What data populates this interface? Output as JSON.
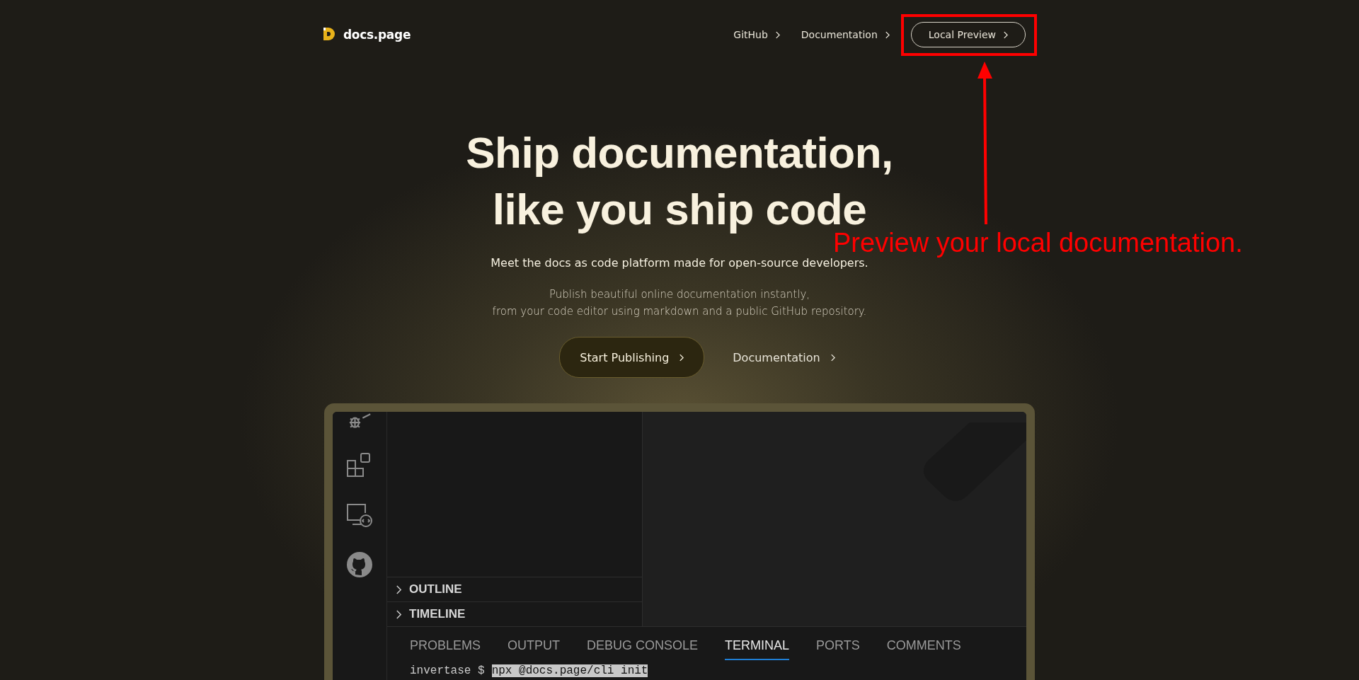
{
  "header": {
    "logo_text": "docs.page",
    "nav": [
      {
        "label": "GitHub",
        "kind": "link"
      },
      {
        "label": "Documentation",
        "kind": "link"
      },
      {
        "label": "Local Preview",
        "kind": "button"
      }
    ]
  },
  "hero": {
    "title_lines": [
      "Ship documentation,",
      "like you ship code"
    ],
    "subtitle": "Meet the docs as code platform made for open-source developers.",
    "description_lines": [
      "Publish beautiful online documentation instantly,",
      "from your code editor using markdown and a public GitHub repository."
    ],
    "actions": [
      {
        "label": "Start Publishing",
        "kind": "primary"
      },
      {
        "label": "Documentation",
        "kind": "link"
      }
    ]
  },
  "editor": {
    "sidebar_sections": [
      {
        "label": "OUTLINE",
        "expanded": false
      },
      {
        "label": "TIMELINE",
        "expanded": false
      }
    ],
    "panel_tabs": [
      {
        "label": "PROBLEMS",
        "selected": false
      },
      {
        "label": "OUTPUT",
        "selected": false
      },
      {
        "label": "DEBUG CONSOLE",
        "selected": false
      },
      {
        "label": "TERMINAL",
        "selected": true
      },
      {
        "label": "PORTS",
        "selected": false
      },
      {
        "label": "COMMENTS",
        "selected": false
      }
    ],
    "terminal": {
      "prompt": "invertase $",
      "command": "npx @docs.page/cli init"
    }
  },
  "annotation": {
    "text": "Preview your local documentation."
  }
}
